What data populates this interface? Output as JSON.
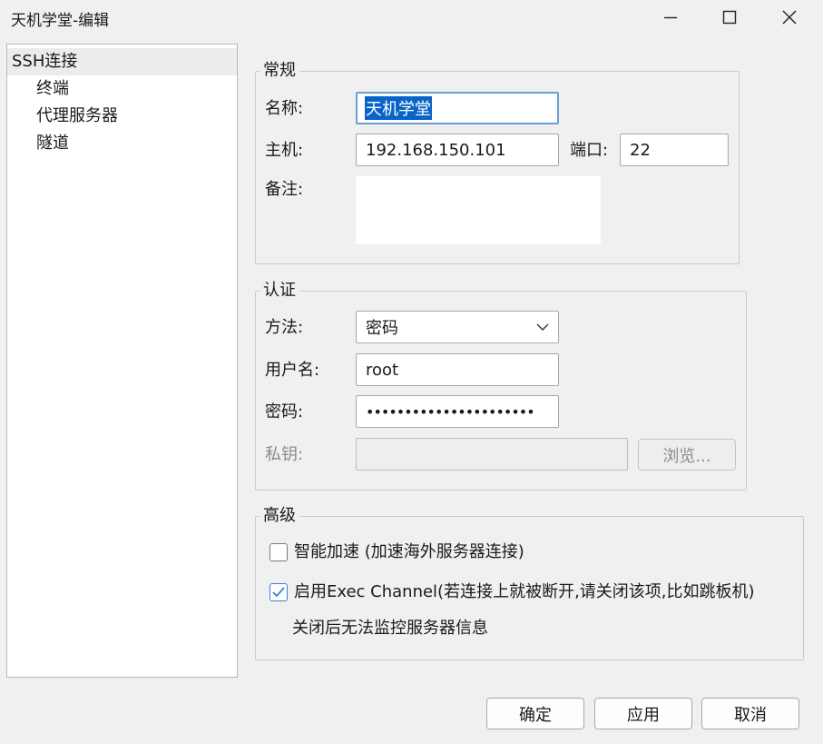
{
  "window": {
    "title": "天机学堂-编辑",
    "controls": {
      "minimize": "minimize-icon",
      "maximize": "maximize-icon",
      "close": "close-icon"
    }
  },
  "sidebar": {
    "items": [
      {
        "label": "SSH连接",
        "selected": true
      },
      {
        "label": "终端"
      },
      {
        "label": "代理服务器"
      },
      {
        "label": "隧道"
      }
    ]
  },
  "general": {
    "legend": "常规",
    "name_label": "名称:",
    "name_value": "天机学堂",
    "host_label": "主机:",
    "host_value": "192.168.150.101",
    "port_label": "端口:",
    "port_value": "22",
    "note_label": "备注:",
    "note_value": ""
  },
  "auth": {
    "legend": "认证",
    "method_label": "方法:",
    "method_value": "密码",
    "username_label": "用户名:",
    "username_value": "root",
    "password_label": "密码:",
    "password_value": "••••••••••••••••••••••",
    "key_label": "私钥:",
    "key_value": "",
    "browse_label": "浏览..."
  },
  "advanced": {
    "legend": "高级",
    "smart_accel_label": "智能加速 (加速海外服务器连接)",
    "smart_accel_checked": false,
    "exec_channel_label": "启用Exec Channel(若连接上就被断开,请关闭该项,比如跳板机)",
    "exec_channel_checked": true,
    "exec_channel_note": "关闭后无法监控服务器信息"
  },
  "footer": {
    "ok_label": "确定",
    "apply_label": "应用",
    "cancel_label": "取消"
  },
  "colors": {
    "accent": "#3d7fd0",
    "selection": "#0a64c8",
    "focus_border": "#6a9ed6"
  }
}
